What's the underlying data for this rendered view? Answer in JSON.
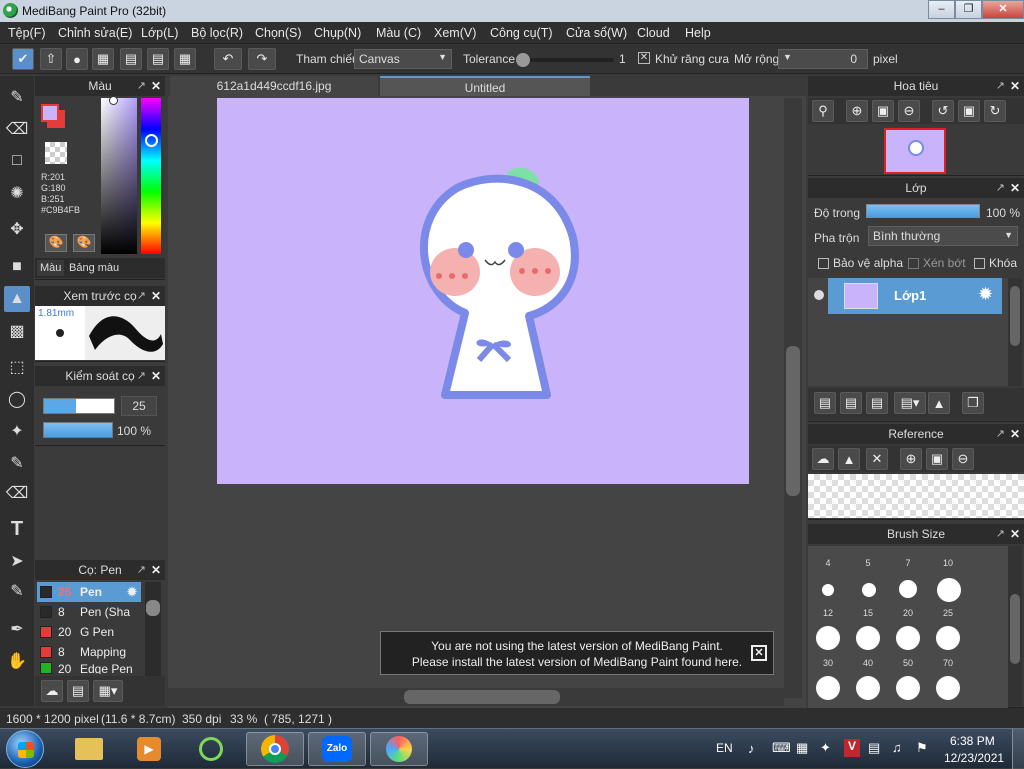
{
  "window": {
    "title": "MediBang Paint Pro (32bit)"
  },
  "menu": [
    "Tệp(F)",
    "Chỉnh sửa(E)",
    "Lớp(L)",
    "Bộ lọc(R)",
    "Chọn(S)",
    "Chụp(N)",
    "Màu (C)",
    "Xem(V)",
    "Công cụ(T)",
    "Cửa sổ(W)",
    "Cloud",
    "Help"
  ],
  "toolbar": {
    "ref_label": "Tham chiếu",
    "ref_value": "Canvas",
    "tolerance_label": "Tolerance",
    "tolerance_value": "1",
    "antialias_label": "Khử răng cưa",
    "expand_label": "Mở rộng",
    "expand_value": "0",
    "expand_unit": "pixel"
  },
  "color_panel": {
    "title": "Màu",
    "r": "R:201",
    "g": "G:180",
    "b": "B:251",
    "hex": "#C9B4FB",
    "tab_color": "Màu",
    "tab_palette": "Bảng màu",
    "fg": "#C9B4FB",
    "bg": "#e63b3b"
  },
  "brush_preview": {
    "title": "Xem trước cọ",
    "size": "1.81mm"
  },
  "brush_control": {
    "title": "Kiểm soát cọ",
    "size": "25",
    "opacity": "100 %"
  },
  "brush_list": {
    "title": "Cọ: Pen",
    "items": [
      {
        "size": "25",
        "name": "Pen",
        "color": "#2a2a2a"
      },
      {
        "size": "8",
        "name": "Pen (Sha",
        "color": "#2a2a2a"
      },
      {
        "size": "20",
        "name": "G Pen",
        "color": "#e63b3b"
      },
      {
        "size": "8",
        "name": "Mapping",
        "color": "#e63b3b"
      },
      {
        "size": "20",
        "name": "Edge Pen",
        "color": "#22b322"
      }
    ]
  },
  "tabs": [
    {
      "label": "612a1d449ccdf16.jpg"
    },
    {
      "label": "Untitled"
    }
  ],
  "navigator": {
    "title": "Hoa tiêu"
  },
  "layer_panel": {
    "title": "Lớp",
    "opacity_label": "Độ trong",
    "opacity_value": "100 %",
    "blend_label": "Pha trộn",
    "blend_value": "Bình thường",
    "protect_alpha": "Bảo vệ alpha",
    "clipping": "Xén bớt",
    "lock": "Khóa",
    "layer_name": "Lớp1"
  },
  "reference_panel": {
    "title": "Reference"
  },
  "brush_size_panel": {
    "title": "Brush Size",
    "row1": [
      "4",
      "5",
      "7",
      "10"
    ],
    "row2": [
      "12",
      "15",
      "20",
      "25"
    ],
    "row3": [
      "30",
      "40",
      "50",
      "70"
    ]
  },
  "notice": {
    "line1": "You are not using the latest version of MediBang Paint.",
    "line2": "Please install the latest version of MediBang Paint found here."
  },
  "status": {
    "dims": "1600 * 1200 pixel",
    "size_cm": "(11.6 * 8.7cm)",
    "dpi": "350 dpi",
    "zoom": "33 %",
    "coords": "( 785, 1271 )"
  },
  "taskbar": {
    "lang": "EN",
    "time": "6:38 PM",
    "date": "12/23/2021",
    "zalo": "Zalo"
  },
  "colors": {
    "accent": "#5a9bd4",
    "canvas_bg": "#C9B4FB",
    "character_outline": "#7b8ae8"
  }
}
